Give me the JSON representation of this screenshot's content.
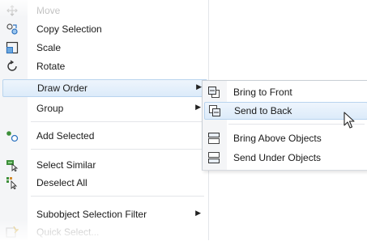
{
  "menu": {
    "items": [
      {
        "label": "Move",
        "icon": "move-icon",
        "disabled": true
      },
      {
        "label": "Copy Selection",
        "icon": "copy-selection-icon"
      },
      {
        "label": "Scale",
        "icon": "scale-icon"
      },
      {
        "label": "Rotate",
        "icon": "rotate-icon"
      },
      {
        "label": "Draw Order",
        "icon": "",
        "submenu_arrow": "▶",
        "highlighted": true
      },
      {
        "label": "Group",
        "icon": "",
        "submenu_arrow": "▶"
      },
      {
        "label": "Add Selected",
        "icon": "add-selected-icon"
      },
      {
        "label": "Select Similar",
        "icon": "select-similar-icon"
      },
      {
        "label": "Deselect All",
        "icon": "deselect-all-icon"
      },
      {
        "label": "Subobject Selection Filter",
        "icon": "",
        "submenu_arrow": "▶"
      },
      {
        "label": "Quick Select...",
        "icon": "quick-select-icon",
        "disabled": true
      }
    ]
  },
  "submenu": {
    "items": [
      {
        "label": "Bring to Front",
        "icon": "bring-to-front-icon"
      },
      {
        "label": "Send to Back",
        "icon": "send-to-back-icon",
        "highlighted": true
      },
      {
        "label": "Bring Above Objects",
        "icon": "bring-above-objects-icon"
      },
      {
        "label": "Send Under Objects",
        "icon": "send-under-objects-icon"
      }
    ]
  },
  "colors": {
    "highlight_border": "#b9d4ee",
    "highlight_fill": "#dcebfa",
    "disabled_text": "#a7a7a7",
    "icon_blue": "#2f74c0",
    "icon_green": "#3d8f3a"
  }
}
